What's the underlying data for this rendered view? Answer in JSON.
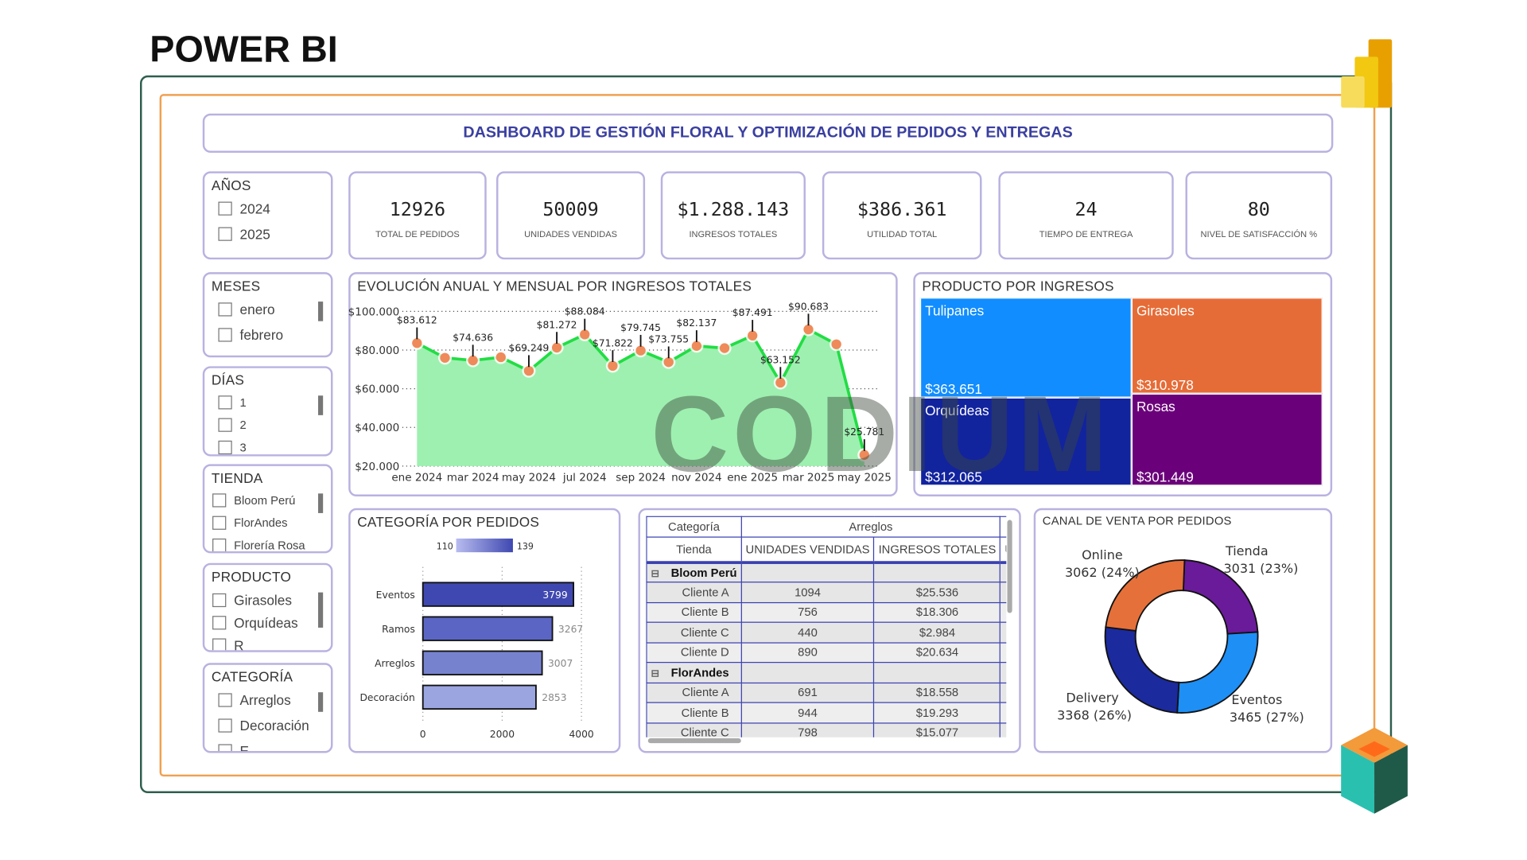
{
  "brand_title": "POWER BI",
  "watermark": "CODIUM",
  "dashboard_title": "DASHBOARD DE GESTIÓN FLORAL Y OPTIMIZACIÓN DE PEDIDOS Y ENTREGAS",
  "slicers": [
    {
      "title": "AÑOS",
      "items": [
        "2024",
        "2025"
      ]
    },
    {
      "title": "MESES",
      "items": [
        "enero",
        "febrero"
      ]
    },
    {
      "title": "DÍAS",
      "items": [
        "1",
        "2",
        "3"
      ]
    },
    {
      "title": "TIENDA",
      "items": [
        "Bloom Perú",
        "FlorAndes",
        "Florería Rosa"
      ]
    },
    {
      "title": "PRODUCTO",
      "items": [
        "Girasoles",
        "Orquídeas",
        "R"
      ]
    },
    {
      "title": "CATEGORÍA",
      "items": [
        "Arreglos",
        "Decoración",
        "E"
      ]
    }
  ],
  "kpis": [
    {
      "value": "12926",
      "label": "TOTAL DE PEDIDOS"
    },
    {
      "value": "50009",
      "label": "UNIDADES VENDIDAS"
    },
    {
      "value": "$1.288.143",
      "label": "INGRESOS TOTALES"
    },
    {
      "value": "$386.361",
      "label": "UTILIDAD TOTAL"
    },
    {
      "value": "24",
      "label": "TIEMPO DE ENTREGA"
    },
    {
      "value": "80",
      "label": "NIVEL DE SATISFACCIÓN %"
    }
  ],
  "chart_data": [
    {
      "type": "area",
      "title": "EVOLUCIÓN ANUAL Y MENSUAL POR INGRESOS TOTALES",
      "x": [
        "ene 2024",
        "feb 2024",
        "mar 2024",
        "abr 2024",
        "may 2024",
        "jun 2024",
        "jul 2024",
        "ago 2024",
        "sep 2024",
        "oct 2024",
        "nov 2024",
        "dic 2024",
        "ene 2025",
        "feb 2025",
        "mar 2025",
        "abr 2025",
        "may 2025"
      ],
      "x_tick_labels": [
        "ene 2024",
        "mar 2024",
        "may 2024",
        "jul 2024",
        "sep 2024",
        "nov 2024",
        "ene 2025",
        "mar 2025",
        "may 2025"
      ],
      "values": [
        83612,
        76000,
        74636,
        76300,
        69249,
        81272,
        88084,
        71822,
        79745,
        73755,
        82137,
        81000,
        87491,
        63152,
        90683,
        83000,
        25781
      ],
      "data_labels": [
        "$83.612",
        "",
        "$74.636",
        "",
        "$69.249",
        "$81.272",
        "$88.084",
        "$71.822",
        "$79.745",
        "$73.755",
        "$82.137",
        "",
        "$87.491",
        "$63.152",
        "$90.683",
        "",
        "$25.781"
      ],
      "y_ticks": [
        "$20.000",
        "$40.000",
        "$60.000",
        "$80.000",
        "$100.000"
      ],
      "ylim": [
        20000,
        100000
      ],
      "grid": true,
      "colors": {
        "line": "#22dd44",
        "fill": "#9ef0b0",
        "marker": "#ef8a5a"
      }
    },
    {
      "type": "bar",
      "title": "CATEGORÍA POR PEDIDOS",
      "orientation": "horizontal",
      "categories": [
        "Eventos",
        "Ramos",
        "Arreglos",
        "Decoración"
      ],
      "values": [
        3799,
        3267,
        3007,
        2853
      ],
      "x_ticks": [
        "0",
        "2000",
        "4000"
      ],
      "xlim": [
        0,
        4000
      ],
      "color_scale": {
        "min_label": "110",
        "max_label": "139"
      },
      "colors": [
        "#3f48b0",
        "#5b66c4",
        "#7782cf",
        "#9ba5df"
      ]
    },
    {
      "type": "pie",
      "title": "CANAL DE VENTA POR PEDIDOS",
      "donut": true,
      "categories": [
        "Tienda",
        "Eventos",
        "Delivery",
        "Online"
      ],
      "values": [
        3031,
        3465,
        3368,
        3062
      ],
      "labels": [
        "3031 (23%)",
        "3465 (27%)",
        "3368 (26%)",
        "3062 (24%)"
      ],
      "colors": [
        "#6a1b9a",
        "#1e8ff5",
        "#1b2a9c",
        "#e6703a"
      ]
    },
    {
      "type": "treemap",
      "title": "PRODUCTO POR INGRESOS",
      "categories": [
        "Tulipanes",
        "Girasoles",
        "Orquídeas",
        "Rosas"
      ],
      "values": [
        "$363.651",
        "$310.978",
        "$312.065",
        "$301.449"
      ],
      "colors": [
        "#118dff",
        "#e66c37",
        "#12239e",
        "#6b007b"
      ]
    }
  ],
  "matrix": {
    "header1": [
      "Categoría",
      "Arreglos"
    ],
    "header2": [
      "Tienda",
      "UNIDADES VENDIDAS",
      "INGRESOS TOTALES",
      "U"
    ],
    "groups": [
      {
        "name": "Bloom Perú",
        "rows": [
          [
            "Cliente A",
            "1094",
            "$25.536"
          ],
          [
            "Cliente B",
            "756",
            "$18.306"
          ],
          [
            "Cliente C",
            "440",
            "$2.984"
          ],
          [
            "Cliente D",
            "890",
            "$20.634"
          ]
        ]
      },
      {
        "name": "FlorAndes",
        "rows": [
          [
            "Cliente A",
            "691",
            "$18.558"
          ],
          [
            "Cliente B",
            "944",
            "$19.293"
          ],
          [
            "Cliente C",
            "798",
            "$15.077"
          ]
        ]
      }
    ]
  }
}
